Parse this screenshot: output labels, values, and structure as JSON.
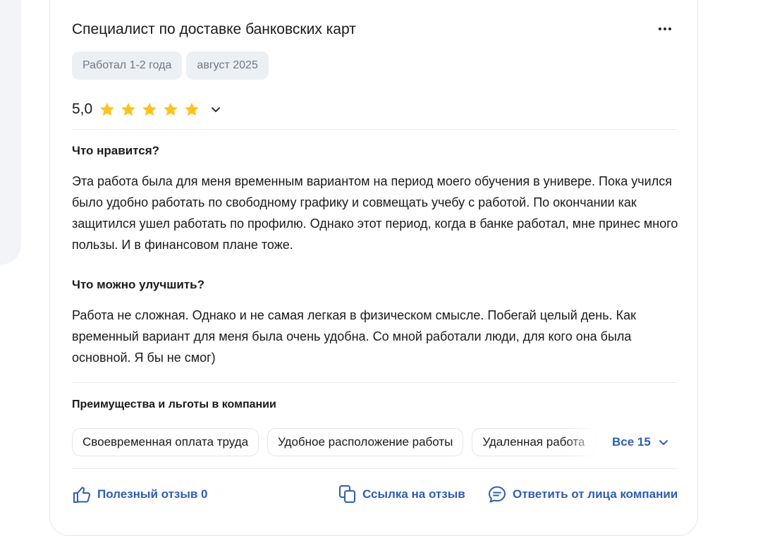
{
  "review": {
    "title": "Специалист по доставке банковских карт",
    "tags": [
      "Работал 1-2 года",
      "август 2025"
    ],
    "rating": "5,0",
    "rating_stars": 5,
    "likes": {
      "title": "Что нравится?",
      "text": "Эта работа была для меня временным вариантом на период моего обучения в универе. Пока учился было удобно работать по свободному графику и совмещать учебу с работой. По окончании как защитился ушел работать по профилю. Однако этот период, когда в банке работал, мне принес много пользы. И в финансовом плане тоже."
    },
    "improve": {
      "title": "Что можно улучшить?",
      "text": "Работа не сложная. Однако и не самая легкая в физическом смысле. Побегай целый день. Как временный вариант для меня была очень удобна. Со мной работали люди, для кого она была основной. Я бы не смог)"
    }
  },
  "benefits": {
    "title": "Преимущества и льготы в компании",
    "chips": [
      "Своевременная оплата труда",
      "Удобное расположение работы",
      "Удаленная работа"
    ],
    "all_label": "Все 15"
  },
  "footer": {
    "helpful_label": "Полезный отзыв 0",
    "link_label": "Ссылка на отзыв",
    "reply_label": "Ответить от лица компании"
  },
  "colors": {
    "accent": "#2e5eb0",
    "star": "#ffc21a",
    "tag_bg": "#edf0f3",
    "panel_bg": "#f2f4f7"
  },
  "icons": {
    "more": "more-dots-icon",
    "star": "star-icon",
    "expand": "chevron-down-icon",
    "helpful": "thumbs-up-icon",
    "link": "copy-link-icon",
    "reply": "chat-bubble-icon"
  }
}
